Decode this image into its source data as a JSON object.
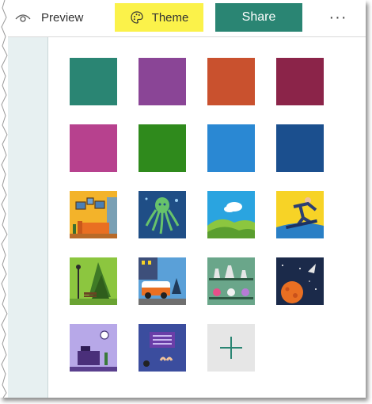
{
  "toolbar": {
    "preview_label": "Preview",
    "theme_label": "Theme",
    "share_label": "Share",
    "more_label": "···"
  },
  "colors": {
    "theme_highlight": "#fbf24a",
    "share_button": "#2a8573",
    "sidebar": "#e7f0f1"
  },
  "themes": {
    "colors": [
      "#2a8573",
      "#8a4596",
      "#c9512e",
      "#8b2449",
      "#b7418e",
      "#2f8a1c",
      "#2a88d3",
      "#1b4f8e"
    ],
    "images": [
      "living-room",
      "octopus",
      "hills",
      "snowboarder",
      "park",
      "camper-van",
      "laboratory",
      "space",
      "desk-room",
      "typewriter"
    ],
    "add_label": "+"
  }
}
